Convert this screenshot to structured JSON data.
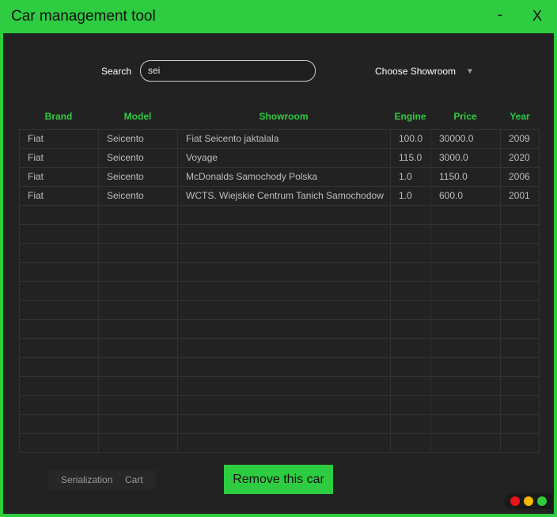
{
  "window": {
    "title": "Car management tool",
    "minimize_label": "-",
    "close_label": "X"
  },
  "search": {
    "label": "Search",
    "value": "sei"
  },
  "showroom_dropdown": {
    "label": "Choose Showroom",
    "icon": "chevron-down-icon"
  },
  "table": {
    "headers": [
      "Brand",
      "Model",
      "Showroom",
      "Engine",
      "Price",
      "Year"
    ],
    "rows": [
      [
        "Fiat",
        "Seicento",
        "Fiat Seicento jaktalala",
        "100.0",
        "30000.0",
        "2009"
      ],
      [
        "Fiat",
        "Seicento",
        "Voyage",
        "115.0",
        "3000.0",
        "2020"
      ],
      [
        "Fiat",
        "Seicento",
        "McDonalds Samochody Polska",
        "1.0",
        "1150.0",
        "2006"
      ],
      [
        "Fiat",
        "Seicento",
        "WCTS. Wiejskie Centrum Tanich Samochodow",
        "1.0",
        "600.0",
        "2001"
      ]
    ]
  },
  "bottom_tabs": [
    "Serialization",
    "Cart"
  ],
  "remove_button": {
    "label": "Remove this car"
  },
  "colors": {
    "accent": "#2ecc40",
    "background": "#222222",
    "dot_red": "#e8141b",
    "dot_yellow": "#f5b800",
    "dot_green": "#2ecc40"
  }
}
